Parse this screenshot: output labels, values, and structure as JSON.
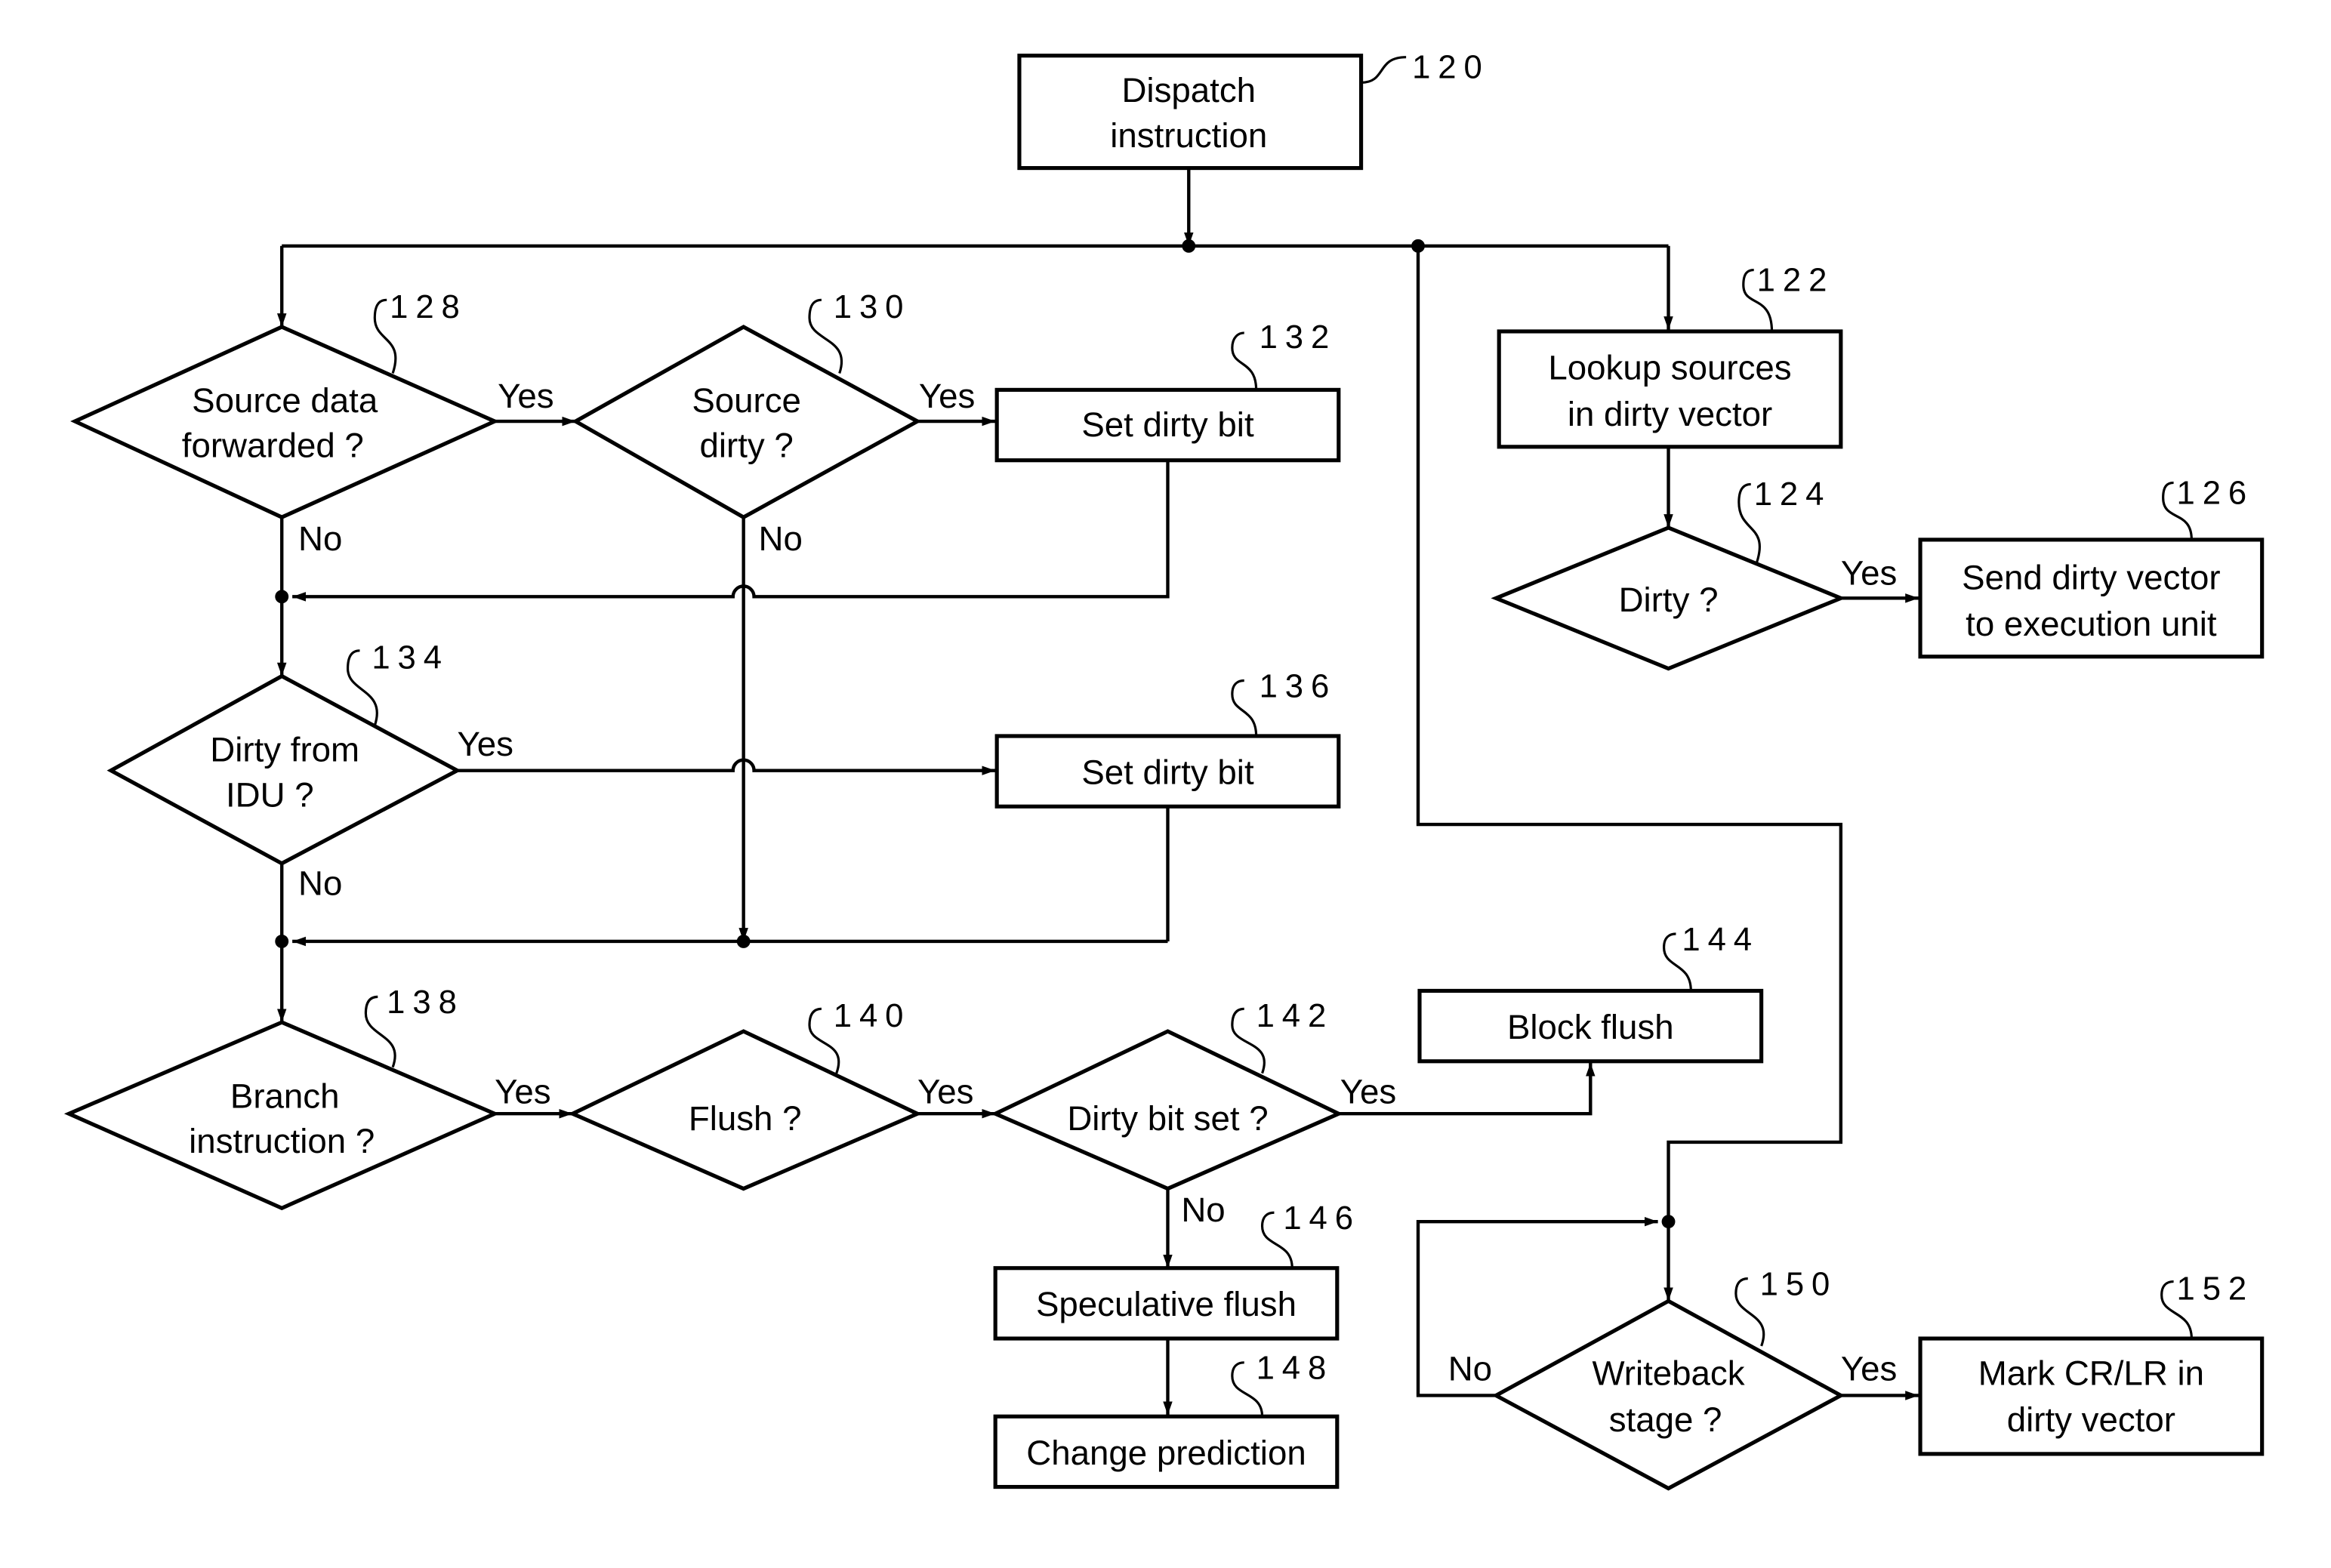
{
  "nodes": {
    "n120": {
      "ref": "120",
      "lines": [
        "Dispatch",
        "instruction"
      ]
    },
    "n122": {
      "ref": "122",
      "lines": [
        "Lookup sources",
        "in dirty vector"
      ]
    },
    "n124": {
      "ref": "124",
      "lines": [
        "Dirty ?"
      ]
    },
    "n126": {
      "ref": "126",
      "lines": [
        "Send dirty vector",
        "to execution unit"
      ]
    },
    "n128": {
      "ref": "128",
      "lines": [
        "Source data",
        "forwarded ?"
      ]
    },
    "n130": {
      "ref": "130",
      "lines": [
        "Source",
        "dirty ?"
      ]
    },
    "n132": {
      "ref": "132",
      "lines": [
        "Set dirty bit"
      ]
    },
    "n134": {
      "ref": "134",
      "lines": [
        "Dirty from",
        "IDU ?"
      ]
    },
    "n136": {
      "ref": "136",
      "lines": [
        "Set dirty bit"
      ]
    },
    "n138": {
      "ref": "138",
      "lines": [
        "Branch",
        "instruction ?"
      ]
    },
    "n140": {
      "ref": "140",
      "lines": [
        "Flush ?"
      ]
    },
    "n142": {
      "ref": "142",
      "lines": [
        "Dirty bit set ?"
      ]
    },
    "n144": {
      "ref": "144",
      "lines": [
        "Block flush"
      ]
    },
    "n146": {
      "ref": "146",
      "lines": [
        "Speculative flush"
      ]
    },
    "n148": {
      "ref": "148",
      "lines": [
        "Change prediction"
      ]
    },
    "n150": {
      "ref": "150",
      "lines": [
        "Writeback",
        "stage ?"
      ]
    },
    "n152": {
      "ref": "152",
      "lines": [
        "Mark CR/LR in",
        "dirty vector"
      ]
    }
  },
  "edges": {
    "yes": "Yes",
    "no": "No"
  }
}
